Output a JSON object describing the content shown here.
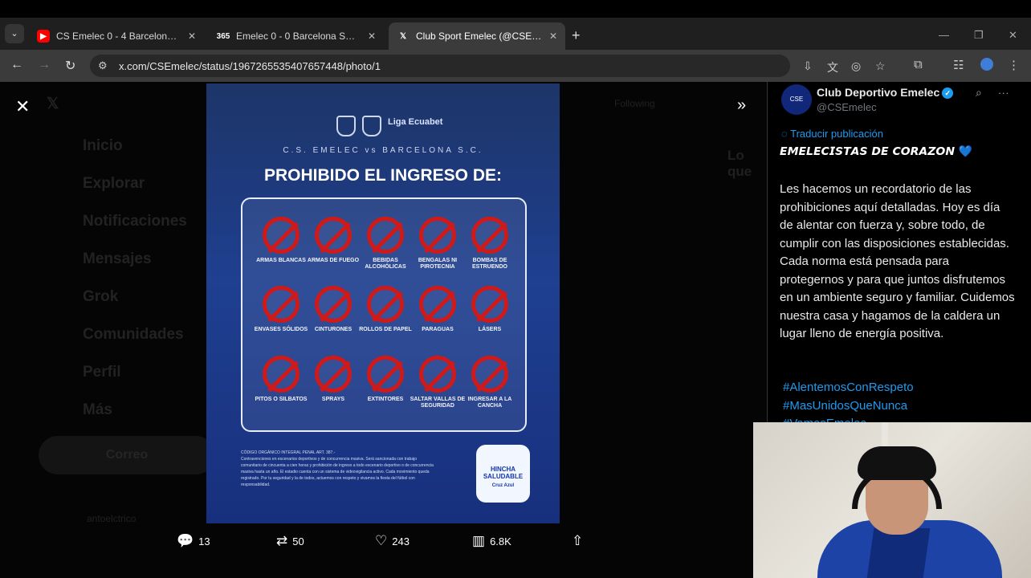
{
  "browser": {
    "tabs": [
      {
        "icon": "youtube-icon",
        "label": "CS Emelec 0 - 4 Barcelona SC /"
      },
      {
        "icon": "scoreboard-icon",
        "label": "Emelec 0 - 0 Barcelona SC (14/"
      },
      {
        "icon": "x-icon",
        "label": "Club Sport Emelec (@CSEmelec"
      }
    ],
    "url": "x.com/CSEmelec/status/1967265535407657448/photo/1"
  },
  "background": {
    "nav_items": [
      "Inicio",
      "Explorar",
      "Notificaciones",
      "Mensajes",
      "Grok",
      "Comunidades",
      "Perfil",
      "Más"
    ],
    "compose": "Correo",
    "following": "Following",
    "trending": "Lo que",
    "user": "antoelctrico"
  },
  "poster": {
    "liga": "Liga Ecuabet",
    "subtitle": "C.S. EMELEC vs BARCELONA S.C.",
    "title": "PROHIBIDO EL INGRESO DE:",
    "items": [
      "ARMAS BLANCAS",
      "ARMAS DE FUEGO",
      "BEBIDAS ALCOHÓLICAS",
      "BENGALAS NI PIROTECNIA",
      "BOMBAS DE ESTRUENDO",
      "ENVASES SÓLIDOS",
      "CINTURONES",
      "ROLLOS DE PAPEL",
      "PARAGUAS",
      "LÁSERS",
      "PITOS O SILBATOS",
      "SPRAYS",
      "EXTINTORES",
      "SALTAR VALLAS DE SEGURIDAD",
      "INGRESAR A LA CANCHA"
    ],
    "legal_title": "CÓDIGO ORGÁNICO INTEGRAL PENAL ART. 387.-",
    "legal_text": "Contravenciones en escenarios deportivos y de concurrencia masiva. Será sancionada con trabajo comunitario de cincuenta a cien horas y prohibición de ingreso a todo escenario deportivo o de concurrencia masiva hasta un año. El estadio cuenta con un sistema de videovigilancia activo. Cada movimiento queda registrado. Por tu seguridad y la de todos, actuemos con respeto y vivamos la fiesta del fútbol con responsabilidad.",
    "badge_title": "HINCHA SALUDABLE",
    "badge_sub": "Cruz Azul"
  },
  "actions": {
    "replies": "13",
    "reposts": "50",
    "likes": "243",
    "views": "6.8K"
  },
  "post": {
    "display_name": "Club Deportivo Emelec",
    "handle": "@CSEmelec",
    "translate": "Traducir publicación",
    "heading": "𝙀𝙈𝙀𝙇𝙀𝘾𝙄𝙎𝙏𝘼𝙎 𝘿𝙀 𝘾𝙊𝙍𝘼𝙕𝙊𝙉",
    "heading_emoji": "💙",
    "body": "Les hacemos un recordatorio de las prohibiciones aquí detalladas. Hoy es día de alentar con fuerza y, sobre todo, de cumplir con las disposiciones establecidas. Cada norma está pensada para protegernos y para que juntos disfrutemos en un ambiente seguro y familiar. Cuidemos nuestra casa y hagamos de la caldera un lugar lleno de energía positiva.",
    "hashtags": [
      "#AlentemosConRespeto",
      "#MasUnidosQueNunca",
      "#VamosEmelec"
    ]
  }
}
